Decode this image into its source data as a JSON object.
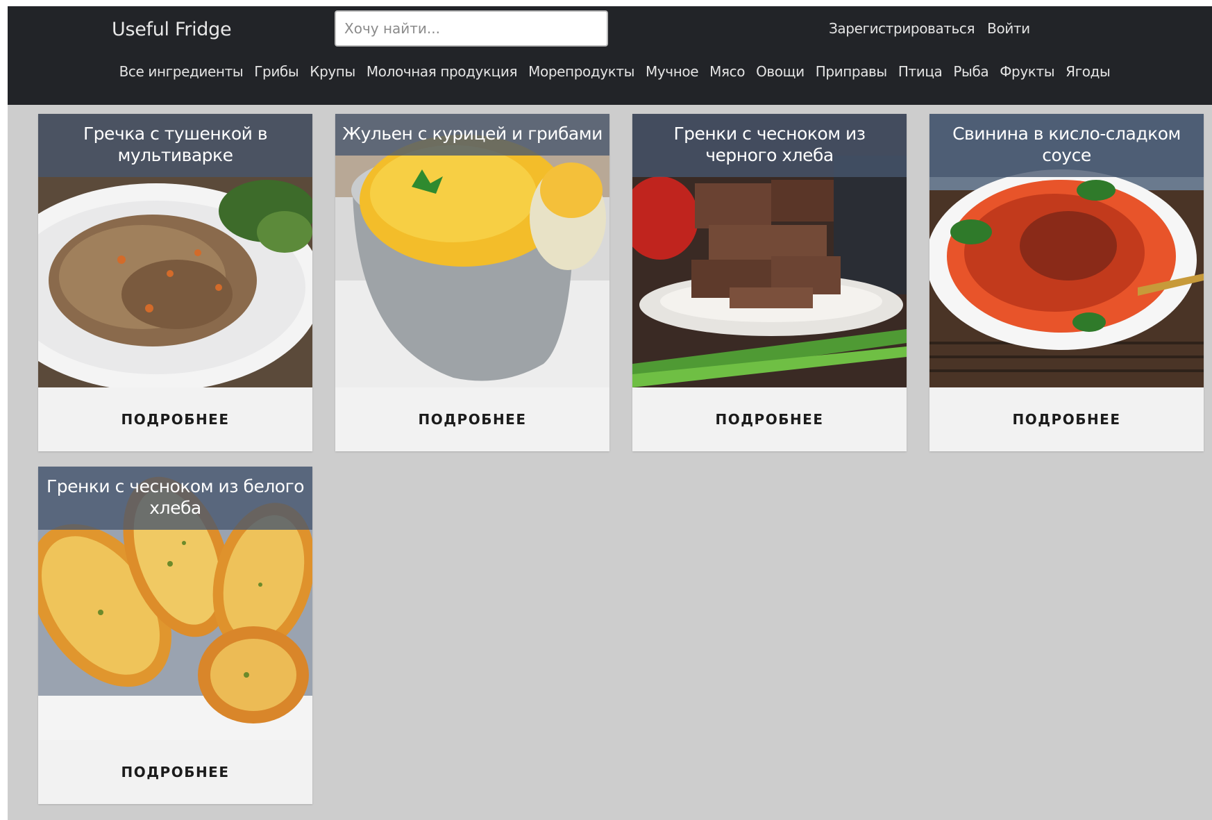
{
  "header": {
    "brand": "Useful Fridge",
    "search_placeholder": "Хочу найти...",
    "auth": {
      "register": "Зарегистрироваться",
      "login": "Войти"
    },
    "nav": [
      "Все ингредиенты",
      "Грибы",
      "Крупы",
      "Молочная продукция",
      "Морепродукты",
      "Мучное",
      "Мясо",
      "Овощи",
      "Приправы",
      "Птица",
      "Рыба",
      "Фрукты",
      "Ягоды"
    ]
  },
  "cards": [
    {
      "title": "Гречка с тушенкой в мультиварке",
      "button": "ПОДРОБНЕЕ"
    },
    {
      "title": "Жульен с курицей и грибами",
      "button": "ПОДРОБНЕЕ"
    },
    {
      "title": "Гренки с чесноком из черного хлеба",
      "button": "ПОДРОБНЕЕ"
    },
    {
      "title": "Свинина в кисло-сладком соусе",
      "button": "ПОДРОБНЕЕ"
    },
    {
      "title": "Гренки с чесноком из белого хлеба",
      "button": "ПОДРОБНЕЕ"
    }
  ],
  "colors": {
    "header_bg": "#222428",
    "page_bg": "#cdcdcd",
    "card_bg": "#f2f2f2",
    "title_overlay": "#46566e"
  }
}
